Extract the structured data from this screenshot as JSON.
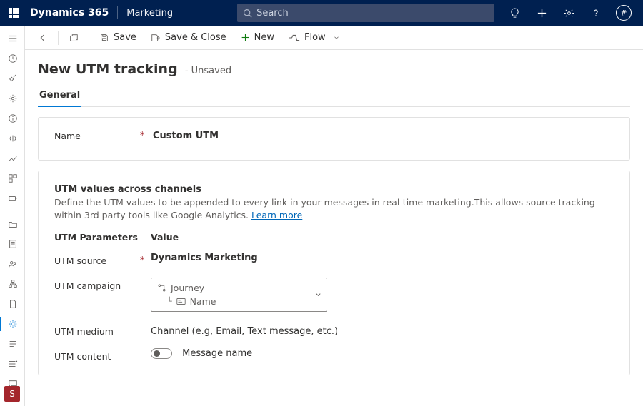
{
  "topbar": {
    "product": "Dynamics 365",
    "module": "Marketing",
    "search_placeholder": "Search",
    "avatar_label": "#"
  },
  "commands": {
    "save": "Save",
    "save_close": "Save & Close",
    "new": "New",
    "flow": "Flow"
  },
  "page": {
    "title": "New UTM tracking",
    "status": "- Unsaved"
  },
  "tabs": [
    {
      "label": "General"
    }
  ],
  "name_field": {
    "label": "Name",
    "value": "Custom UTM"
  },
  "section": {
    "title": "UTM values across channels",
    "desc_prefix": "Define the UTM values to be appended to every link in your messages in real-time marketing.This allows source tracking within 3rd party tools like Google Analytics. ",
    "link": "Learn more"
  },
  "param_table": {
    "col1": "UTM Parameters",
    "col2": "Value"
  },
  "params": {
    "source": {
      "label": "UTM source",
      "value": "Dynamics Marketing"
    },
    "campaign": {
      "label": "UTM campaign",
      "line1": "Journey",
      "line2": "Name"
    },
    "medium": {
      "label": "UTM medium",
      "value": "Channel (e.g, Email, Text message, etc.)"
    },
    "content": {
      "label": "UTM content",
      "value": "Message name"
    }
  },
  "sidebar_bottom": "S"
}
